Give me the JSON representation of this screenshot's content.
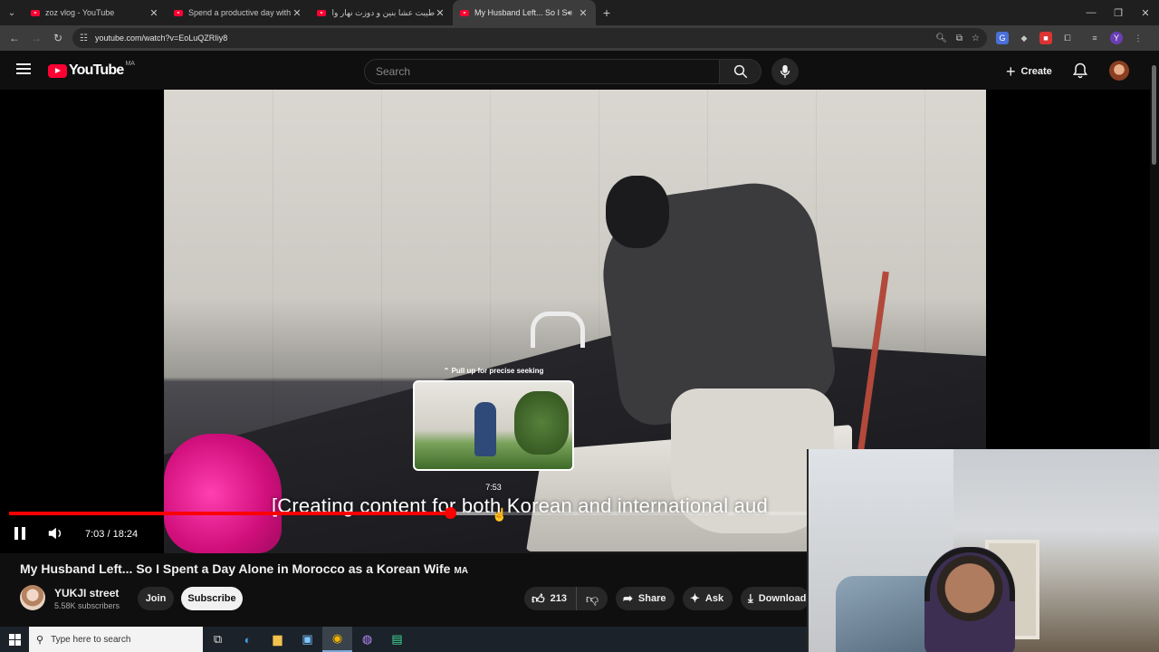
{
  "browser": {
    "tabs": [
      {
        "label": "zoz vlog - YouTube",
        "active": false
      },
      {
        "label": "Spend a productive day with m",
        "active": false
      },
      {
        "label": "طيبت عشا بنين و دوزت نهار واعر",
        "active": false
      },
      {
        "label": "My Husband Left... So I Spe",
        "active": true
      }
    ],
    "url": "youtube.com/watch?v=EoLuQZRIiy8"
  },
  "youtube": {
    "logo_text": "YouTube",
    "country_code": "MA",
    "search_placeholder": "Search",
    "create_label": "Create"
  },
  "player": {
    "seek_hint": "Pull up for precise seeking",
    "hover_time": "7:53",
    "caption": "[Creating content for both Korean and international aud",
    "current_time": "7:03",
    "duration": "18:24",
    "time_display": "7:03 / 18:24",
    "played_fraction": 0.3895,
    "buffered_fraction": 0.43,
    "hover_fraction": 0.4295
  },
  "video": {
    "title": "My Husband Left... So I Spent a Day Alone in Morocco as a Korean Wife",
    "title_badge": "MA",
    "channel_name": "YUKJI street",
    "subscribers": "5.58K subscribers",
    "join_label": "Join",
    "subscribe_label": "Subscribe",
    "likes": "213",
    "share_label": "Share",
    "ask_label": "Ask",
    "download_label": "Download"
  },
  "taskbar": {
    "search_placeholder": "Type here to search"
  },
  "colors": {
    "accent_red": "#ff0000",
    "background": "#0f0f0f"
  }
}
